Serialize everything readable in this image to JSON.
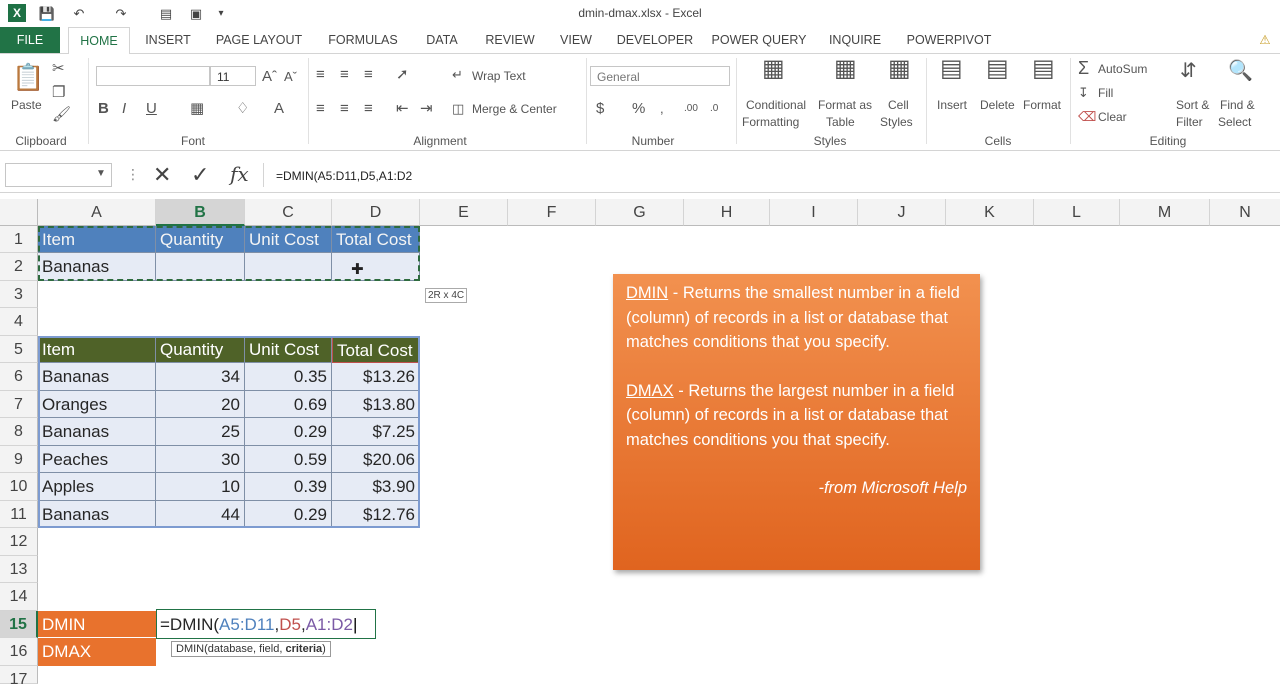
{
  "window": {
    "title": "dmin-dmax.xlsx - Excel"
  },
  "tabs": [
    "FILE",
    "HOME",
    "INSERT",
    "PAGE LAYOUT",
    "FORMULAS",
    "DATA",
    "REVIEW",
    "VIEW",
    "DEVELOPER",
    "POWER QUERY",
    "INQUIRE",
    "POWERPIVOT"
  ],
  "ribbon": {
    "clipboard": {
      "paste": "Paste",
      "group": "Clipboard"
    },
    "font": {
      "size": "11",
      "group": "Font"
    },
    "alignment": {
      "wrap_text": "Wrap Text",
      "merge_center": "Merge & Center",
      "group": "Alignment"
    },
    "number": {
      "format": "General",
      "group": "Number"
    },
    "styles": {
      "conditional_1": "Conditional",
      "conditional_2": "Formatting",
      "format_as_1": "Format as",
      "format_as_2": "Table",
      "cell_styles_1": "Cell",
      "cell_styles_2": "Styles",
      "group": "Styles"
    },
    "cells": {
      "insert": "Insert",
      "delete": "Delete",
      "format": "Format",
      "group": "Cells"
    },
    "editing": {
      "autosum": "AutoSum",
      "fill": "Fill",
      "clear": "Clear",
      "sort_1": "Sort &",
      "sort_2": "Filter",
      "find_1": "Find &",
      "find_2": "Select",
      "group": "Editing"
    }
  },
  "formula_bar": {
    "name_box": "",
    "formula": "=DMIN(A5:D11,D5,A1:D2"
  },
  "columns": [
    "A",
    "B",
    "C",
    "D",
    "E",
    "F",
    "G",
    "H",
    "I",
    "J",
    "K",
    "L",
    "M",
    "N"
  ],
  "rows": [
    "1",
    "2",
    "3",
    "4",
    "5",
    "6",
    "7",
    "8",
    "9",
    "10",
    "11",
    "12",
    "13",
    "14",
    "15",
    "16",
    "17"
  ],
  "criteria_table": {
    "headers": [
      "Item",
      "Quantity",
      "Unit Cost",
      "Total Cost"
    ],
    "row": [
      "Bananas",
      "",
      "",
      ""
    ]
  },
  "data_table": {
    "headers": [
      "Item",
      "Quantity",
      "Unit Cost",
      "Total Cost"
    ],
    "rows": [
      [
        "Bananas",
        "34",
        "0.35",
        "$13.26"
      ],
      [
        "Oranges",
        "20",
        "0.69",
        "$13.80"
      ],
      [
        "Bananas",
        "25",
        "0.29",
        "$7.25"
      ],
      [
        "Peaches",
        "30",
        "0.59",
        "$20.06"
      ],
      [
        "Apples",
        "10",
        "0.39",
        "$3.90"
      ],
      [
        "Bananas",
        "44",
        "0.29",
        "$12.76"
      ]
    ]
  },
  "results": {
    "dmin_label": "DMIN",
    "dmax_label": "DMAX"
  },
  "editing_formula": {
    "prefix": "=DMIN(",
    "arg1": "A5:D11",
    "comma1": ",",
    "arg2": "D5",
    "comma2": ",",
    "arg3": "A1:D2"
  },
  "tooltip": {
    "fn": "DMIN(",
    "args": "database, field, ",
    "bold_arg": "criteria",
    "close": ")"
  },
  "size_tip": "2R x 4C",
  "callout": {
    "dmin_term": "DMIN",
    "dmin_text": " - Returns the smallest number in a field (column) of records in a list or database that matches conditions that you specify.",
    "dmax_term": "DMAX",
    "dmax_text": " - Returns the largest number in a field (column) of records in a list or database that matches conditions you that specify.",
    "source": "-from Microsoft Help"
  },
  "colors": {
    "excel_green": "#217346",
    "header_blue": "#4f81bd",
    "header_green": "#4f6228",
    "orange": "#e8722d"
  }
}
